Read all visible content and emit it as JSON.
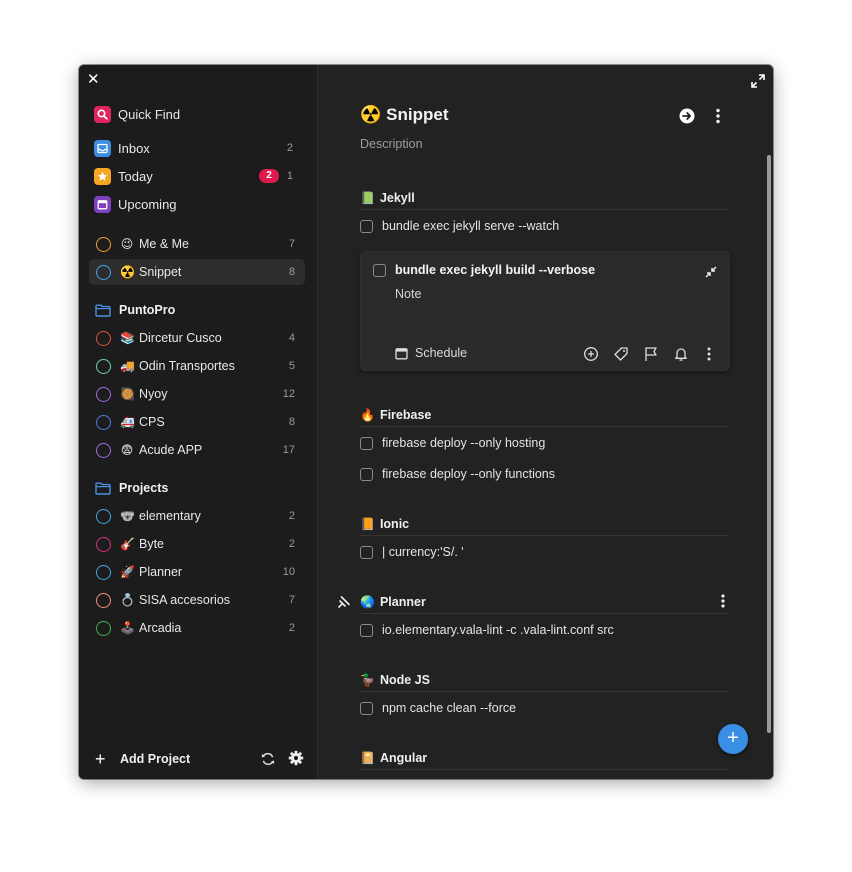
{
  "sidebar": {
    "quick_find": "Quick Find",
    "inbox": {
      "label": "Inbox",
      "count": "2"
    },
    "today": {
      "label": "Today",
      "badge": "2",
      "count": "1"
    },
    "upcoming": {
      "label": "Upcoming"
    },
    "projects_top": [
      {
        "emoji": "😉",
        "label": "Me & Me",
        "count": "7",
        "color": "#f39c2a"
      },
      {
        "emoji": "☢️",
        "label": "Snippet",
        "count": "8",
        "color": "#3ea6e6"
      }
    ],
    "area1": {
      "label": "PuntoPro",
      "projects": [
        {
          "emoji": "📚",
          "label": "Dircetur Cusco",
          "count": "4",
          "color": "#e0533f"
        },
        {
          "emoji": "🚚",
          "label": "Odin Transportes",
          "count": "5",
          "color": "#6fd4b6"
        },
        {
          "emoji": "🥘",
          "label": "Nyoy",
          "count": "12",
          "color": "#9c6ae6"
        },
        {
          "emoji": "🚑",
          "label": "CPS",
          "count": "8",
          "color": "#4f7be6"
        },
        {
          "emoji": "😨",
          "label": "Acude APP",
          "count": "17",
          "color": "#9c6ae6"
        }
      ]
    },
    "area2": {
      "label": "Projects",
      "projects": [
        {
          "emoji": "🐨",
          "label": "elementary",
          "count": "2",
          "color": "#3ea6e6"
        },
        {
          "emoji": "🎸",
          "label": "Byte",
          "count": "2",
          "color": "#d4327e"
        },
        {
          "emoji": "🚀",
          "label": "Planner",
          "count": "10",
          "color": "#3ea6e6"
        },
        {
          "emoji": "💍",
          "label": "SISA accesorios",
          "count": "7",
          "color": "#f2917a"
        },
        {
          "emoji": "🕹️",
          "label": "Arcadia",
          "count": "2",
          "color": "#3cb24a"
        }
      ]
    },
    "add_project": "Add Project"
  },
  "main": {
    "title": "Snippet",
    "title_emoji": "☢️",
    "description": "Description",
    "sections": [
      {
        "emoji": "📗",
        "label": "Jekyll"
      },
      {
        "emoji": "🔥",
        "label": "Firebase"
      },
      {
        "emoji": "📙",
        "label": "Ionic"
      },
      {
        "emoji": "🌏",
        "label": "Planner"
      },
      {
        "emoji": "🦆",
        "label": "Node JS"
      },
      {
        "emoji": "📔",
        "label": "Angular"
      }
    ],
    "tasks": [
      "bundle exec jekyll serve --watch",
      "firebase deploy --only hosting",
      "firebase deploy --only functions",
      "| currency:'S/. '",
      "io.elementary.vala-lint -c .vala-lint.conf src",
      "npm cache clean --force"
    ],
    "card": {
      "title": "bundle exec jekyll build --verbose",
      "note": "Note",
      "schedule": "Schedule"
    }
  },
  "colors": {
    "accent": "#3a8ee6",
    "badge": "#e01b4b",
    "quick_find": "#e0245e",
    "inbox": "#3d8ee0",
    "today": "#f5a623",
    "upcoming": "#7f3fbf"
  },
  "icons": [
    "close-icon",
    "maximize-icon",
    "search-icon",
    "inbox-icon",
    "star-icon",
    "calendar-icon",
    "folder-icon",
    "plus-icon",
    "sync-icon",
    "gear-icon",
    "arrow-right-circle-icon",
    "more-vertical-icon",
    "collapse-icon",
    "add-circle-icon",
    "tag-icon",
    "flag-icon",
    "bell-icon",
    "pin-icon"
  ]
}
